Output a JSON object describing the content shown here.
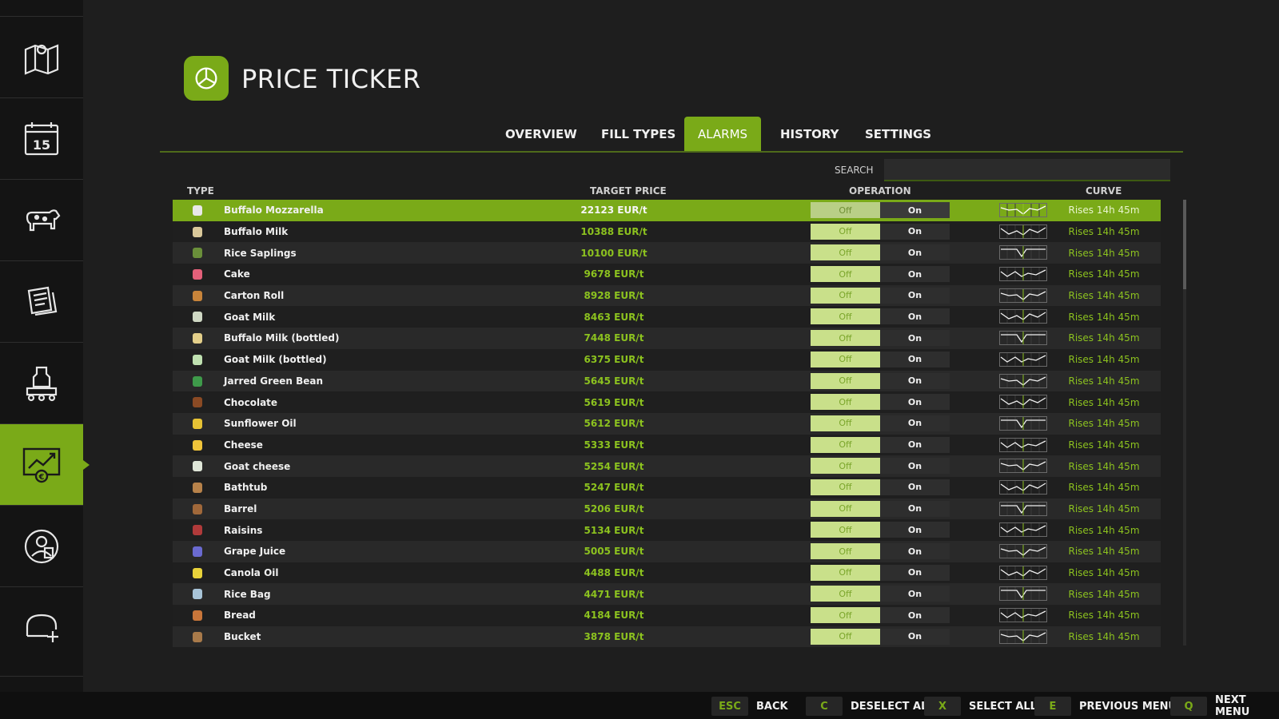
{
  "sidebar": {
    "items": [
      {
        "icon": "map-icon",
        "active": false
      },
      {
        "icon": "calendar-icon",
        "label": "15",
        "active": false
      },
      {
        "icon": "animals-icon",
        "active": false
      },
      {
        "icon": "contracts-icon",
        "active": false
      },
      {
        "icon": "production-icon",
        "active": false
      },
      {
        "icon": "price-chart-icon",
        "active": true
      },
      {
        "icon": "workers-icon",
        "active": false
      },
      {
        "icon": "help-icon",
        "active": false
      }
    ]
  },
  "header": {
    "title": "PRICE TICKER",
    "logo_icon": "price-ticker-logo-icon"
  },
  "tabs": [
    {
      "label": "OVERVIEW",
      "active": false
    },
    {
      "label": "FILL TYPES",
      "active": false
    },
    {
      "label": "ALARMS",
      "active": true
    },
    {
      "label": "HISTORY",
      "active": false
    },
    {
      "label": "SETTINGS",
      "active": false
    }
  ],
  "search": {
    "label": "SEARCH",
    "value": ""
  },
  "columns": {
    "type": "TYPE",
    "target_price": "TARGET PRICE",
    "operation": "OPERATION",
    "curve": "CURVE"
  },
  "rows": [
    {
      "name": "Buffalo Mozzarella",
      "price": "22123 EUR/t",
      "off": "Off",
      "on": "On",
      "curve": "Rises 14h 45m",
      "selected": true,
      "icon_color": "#e8e8e8"
    },
    {
      "name": "Buffalo Milk",
      "price": "10388 EUR/t",
      "off": "Off",
      "on": "On",
      "curve": "Rises 14h 45m",
      "icon_color": "#d9c89a"
    },
    {
      "name": "Rice Saplings",
      "price": "10100 EUR/t",
      "off": "Off",
      "on": "On",
      "curve": "Rises 14h 45m",
      "icon_color": "#6a8f3a"
    },
    {
      "name": "Cake",
      "price": "9678 EUR/t",
      "off": "Off",
      "on": "On",
      "curve": "Rises 14h 45m",
      "icon_color": "#e4607a"
    },
    {
      "name": "Carton Roll",
      "price": "8928 EUR/t",
      "off": "Off",
      "on": "On",
      "curve": "Rises 14h 45m",
      "icon_color": "#c8843a"
    },
    {
      "name": "Goat Milk",
      "price": "8463 EUR/t",
      "off": "Off",
      "on": "On",
      "curve": "Rises 14h 45m",
      "icon_color": "#cfd8c4"
    },
    {
      "name": "Buffalo Milk (bottled)",
      "price": "7448 EUR/t",
      "off": "Off",
      "on": "On",
      "curve": "Rises 14h 45m",
      "icon_color": "#e3cf8a"
    },
    {
      "name": "Goat Milk (bottled)",
      "price": "6375 EUR/t",
      "off": "Off",
      "on": "On",
      "curve": "Rises 14h 45m",
      "icon_color": "#bfe0b0"
    },
    {
      "name": "Jarred Green Bean",
      "price": "5645 EUR/t",
      "off": "Off",
      "on": "On",
      "curve": "Rises 14h 45m",
      "icon_color": "#3e9a4a"
    },
    {
      "name": "Chocolate",
      "price": "5619 EUR/t",
      "off": "Off",
      "on": "On",
      "curve": "Rises 14h 45m",
      "icon_color": "#8a4a24"
    },
    {
      "name": "Sunflower Oil",
      "price": "5612 EUR/t",
      "off": "Off",
      "on": "On",
      "curve": "Rises 14h 45m",
      "icon_color": "#e6c234"
    },
    {
      "name": "Cheese",
      "price": "5333 EUR/t",
      "off": "Off",
      "on": "On",
      "curve": "Rises 14h 45m",
      "icon_color": "#f0c43a"
    },
    {
      "name": "Goat cheese",
      "price": "5254 EUR/t",
      "off": "Off",
      "on": "On",
      "curve": "Rises 14h 45m",
      "icon_color": "#dfe6d8"
    },
    {
      "name": "Bathtub",
      "price": "5247 EUR/t",
      "off": "Off",
      "on": "On",
      "curve": "Rises 14h 45m",
      "icon_color": "#b7824a"
    },
    {
      "name": "Barrel",
      "price": "5206 EUR/t",
      "off": "Off",
      "on": "On",
      "curve": "Rises 14h 45m",
      "icon_color": "#a0683a"
    },
    {
      "name": "Raisins",
      "price": "5134 EUR/t",
      "off": "Off",
      "on": "On",
      "curve": "Rises 14h 45m",
      "icon_color": "#b03a3a"
    },
    {
      "name": "Grape Juice",
      "price": "5005 EUR/t",
      "off": "Off",
      "on": "On",
      "curve": "Rises 14h 45m",
      "icon_color": "#6a6ad0"
    },
    {
      "name": "Canola Oil",
      "price": "4488 EUR/t",
      "off": "Off",
      "on": "On",
      "curve": "Rises 14h 45m",
      "icon_color": "#e8d23a"
    },
    {
      "name": "Rice Bag",
      "price": "4471 EUR/t",
      "off": "Off",
      "on": "On",
      "curve": "Rises 14h 45m",
      "icon_color": "#a8c4d8"
    },
    {
      "name": "Bread",
      "price": "4184 EUR/t",
      "off": "Off",
      "on": "On",
      "curve": "Rises 14h 45m",
      "icon_color": "#c9763a"
    },
    {
      "name": "Bucket",
      "price": "3878 EUR/t",
      "off": "Off",
      "on": "On",
      "curve": "Rises 14h 45m",
      "icon_color": "#a87a4a"
    }
  ],
  "footer": [
    {
      "key": "ESC",
      "label": "BACK"
    },
    {
      "key": "C",
      "label": "DESELECT ALL"
    },
    {
      "key": "X",
      "label": "SELECT ALL"
    },
    {
      "key": "E",
      "label": "PREVIOUS MENU"
    },
    {
      "key": "Q",
      "label": "NEXT MENU"
    }
  ],
  "colors": {
    "accent": "#7aaa18",
    "price_text": "#8cc21f",
    "background": "#1e1e1e"
  }
}
